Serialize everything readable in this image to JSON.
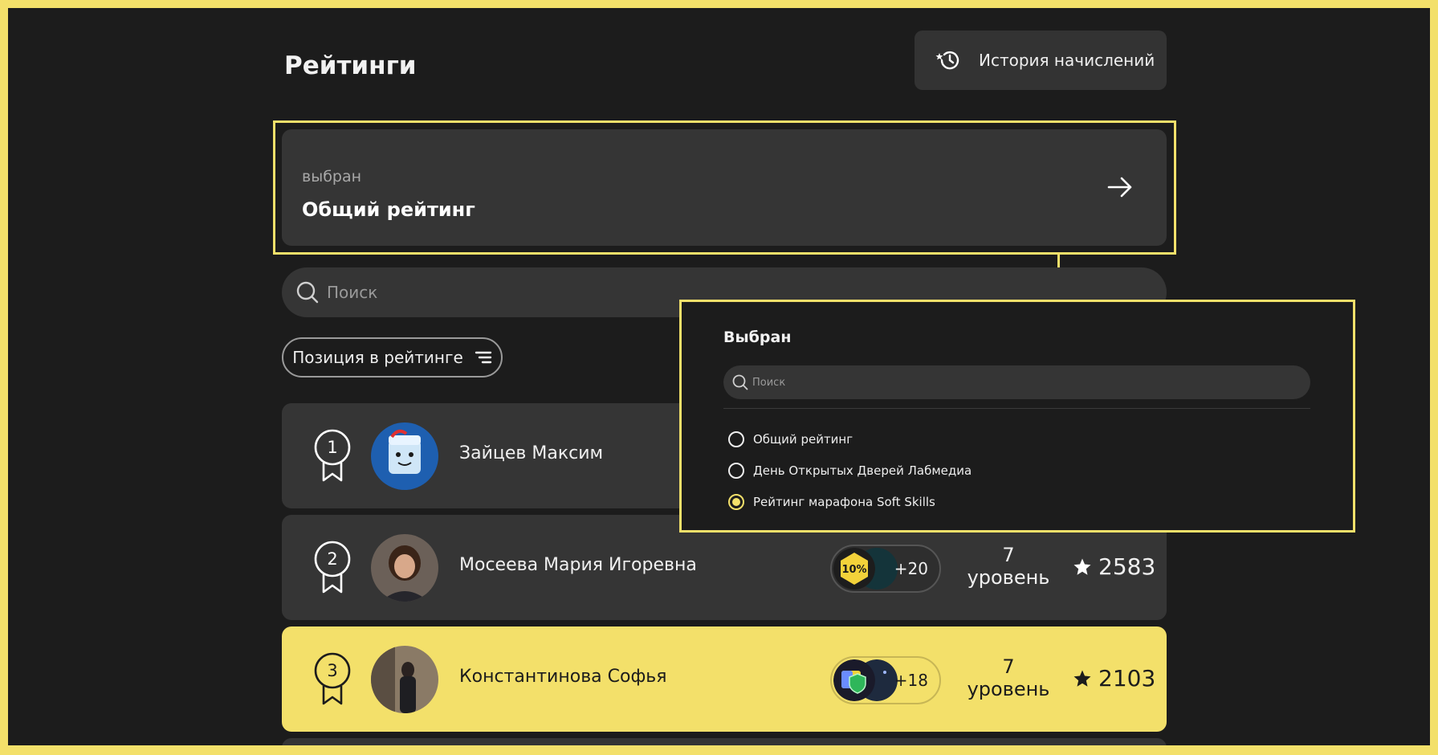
{
  "page": {
    "title": "Рейтинги"
  },
  "history_button": {
    "label": "История начислений",
    "icon": "history-clock-icon"
  },
  "selected": {
    "caption": "выбран",
    "value": "Общий рейтинг",
    "icon": "arrow-right-icon"
  },
  "search": {
    "placeholder": "Поиск"
  },
  "sort": {
    "label": "Позиция в рейтинге",
    "icon": "sort-lines-icon"
  },
  "rows": [
    {
      "rank": "1",
      "name": "Зайцев Максим"
    },
    {
      "rank": "2",
      "name": "Мосеева Мария Игоревна",
      "badge_text": "10%",
      "badge_extra": "+20",
      "level_num": "7",
      "level_word": "уровень",
      "points": "2583"
    },
    {
      "rank": "3",
      "name": "Константинова Софья",
      "badge_extra": "+18",
      "level_num": "7",
      "level_word": "уровень",
      "points": "2103"
    }
  ],
  "popup": {
    "title": "Выбран",
    "search_placeholder": "Поиск",
    "options": [
      {
        "label": "Общий рейтинг",
        "checked": false
      },
      {
        "label": "День Открытых Дверей Лабмедиа",
        "checked": false
      },
      {
        "label": "Рейтинг марафона Soft Skills",
        "checked": true
      }
    ]
  },
  "colors": {
    "accent": "#f3e06a",
    "background": "#1c1c1c",
    "card": "#353535"
  }
}
